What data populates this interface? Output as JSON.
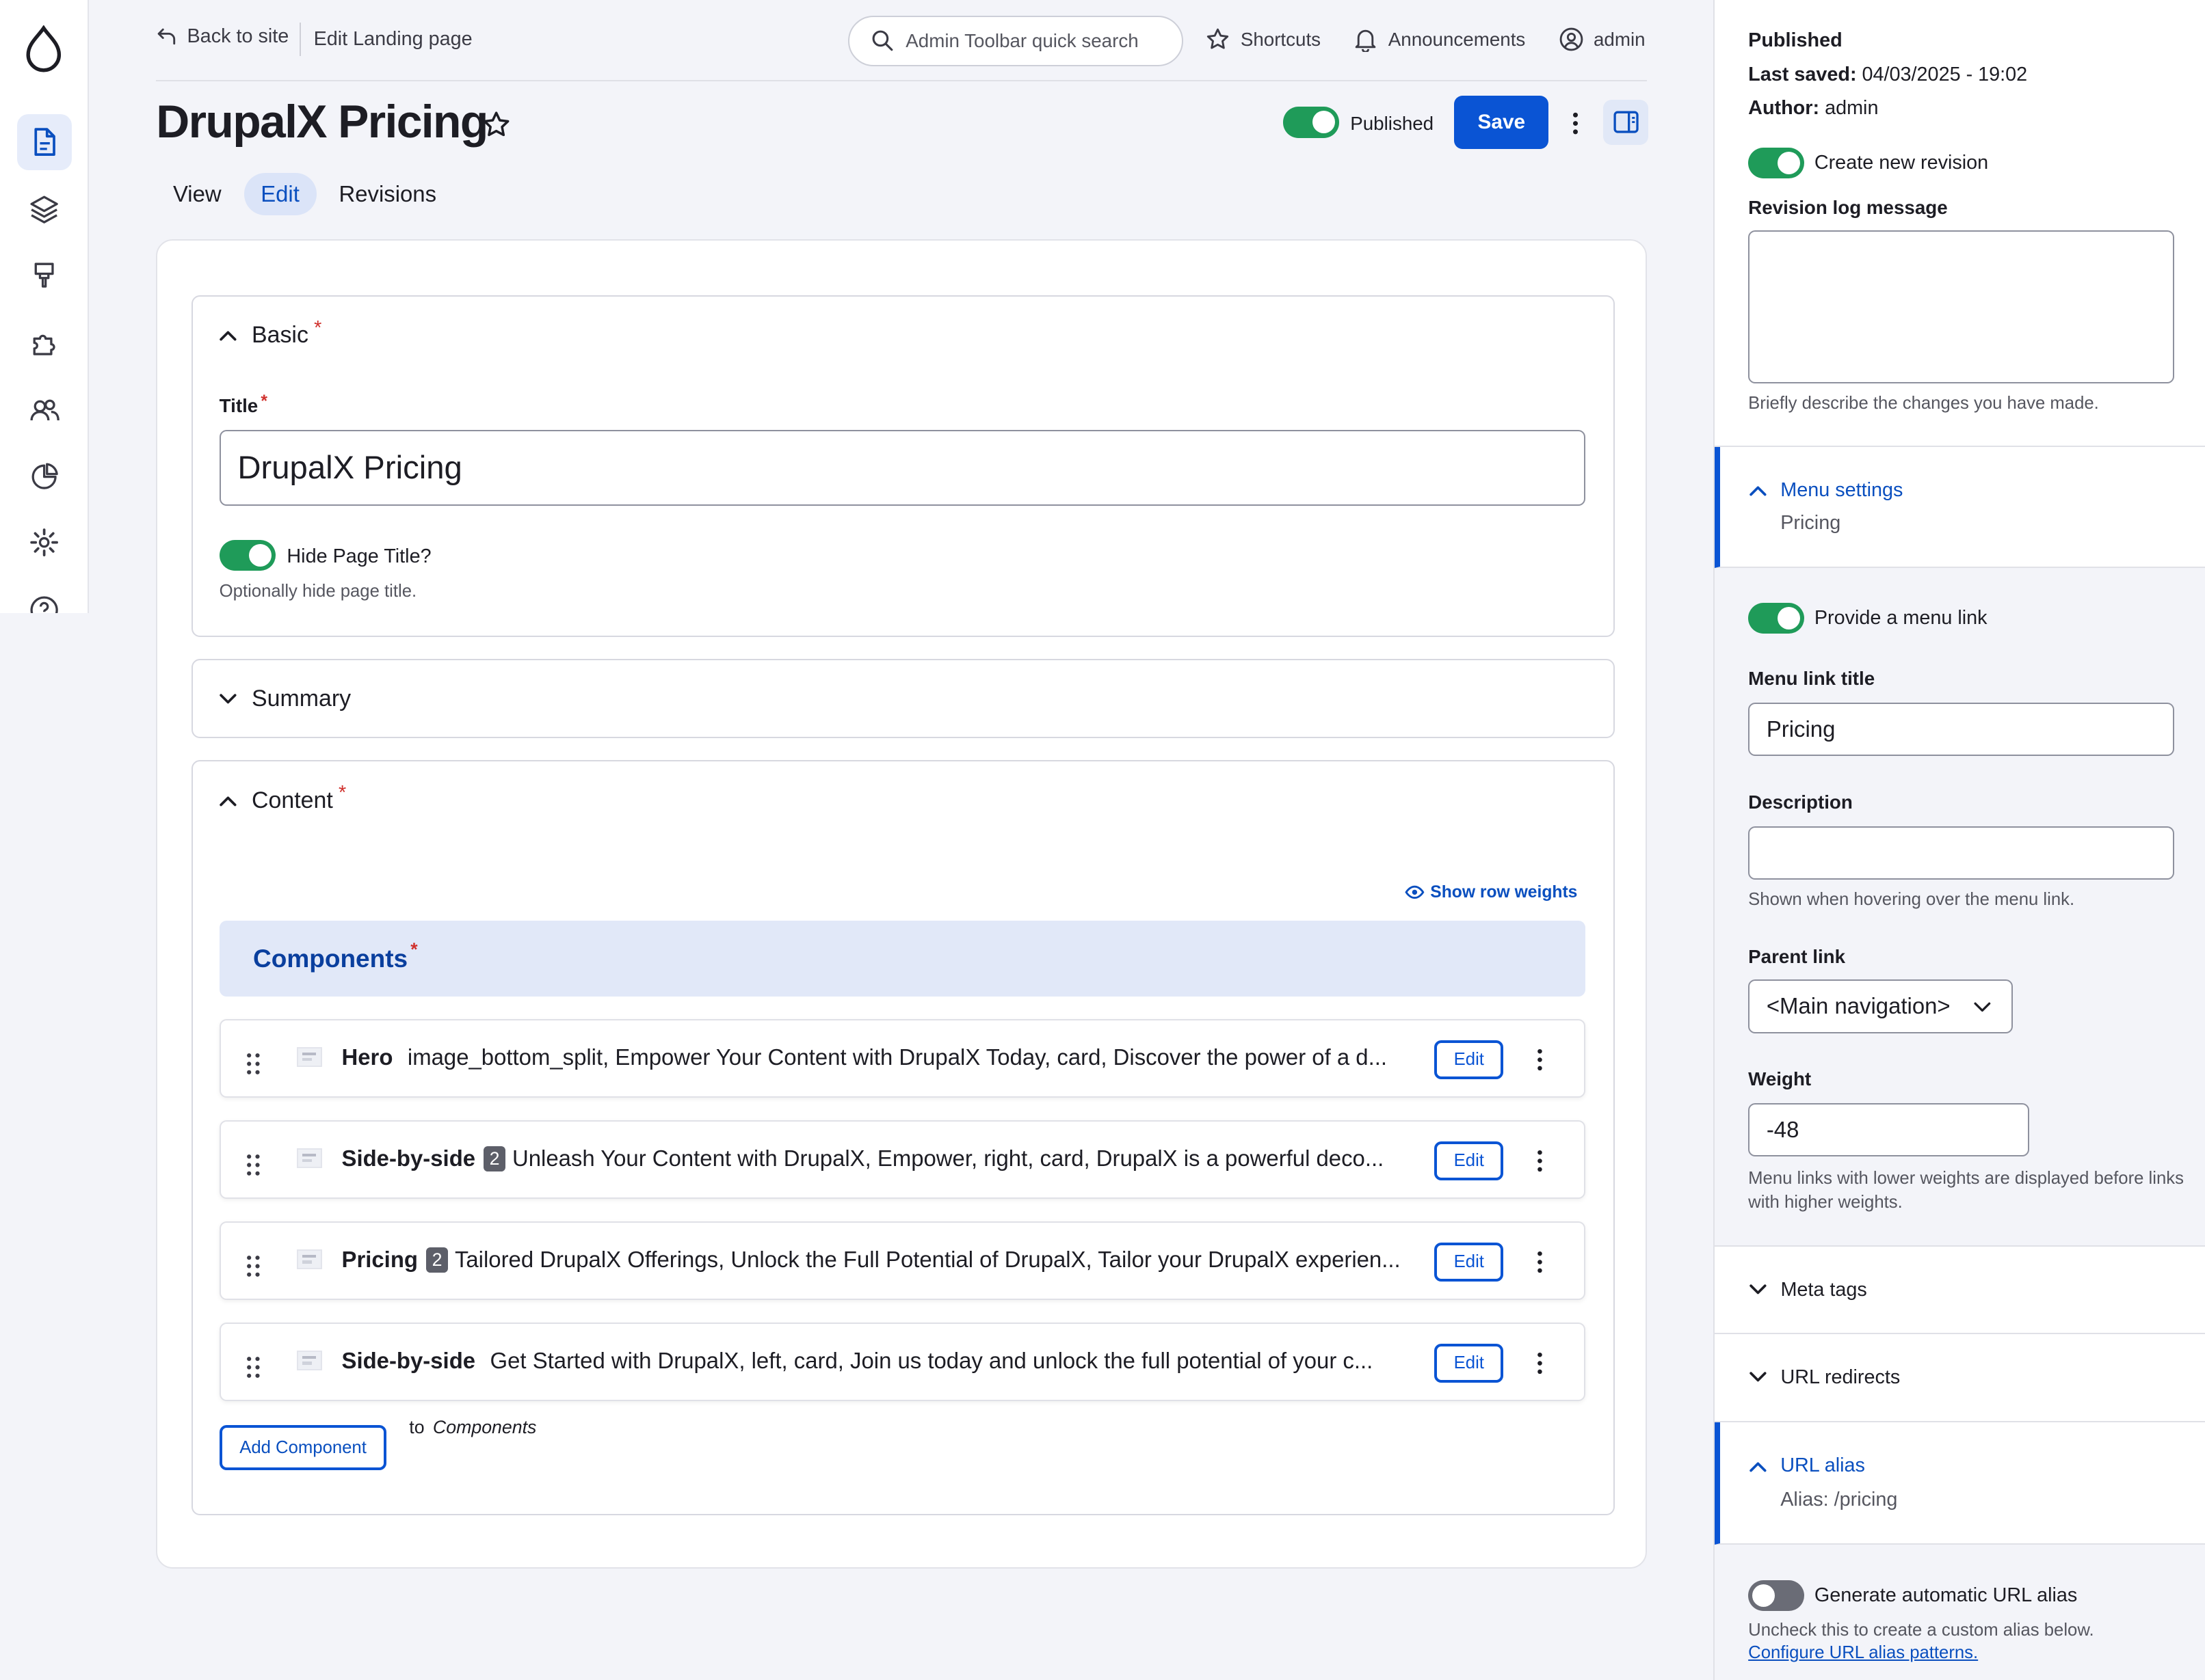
{
  "colors": {
    "accent": "#0a54d4",
    "toggle_on": "#1f9b59",
    "required": "#d0312d",
    "components_bg": "#e1e8f8"
  },
  "toolbar": {
    "back_label": "Back to site",
    "breadcrumb": "Edit Landing page",
    "search_placeholder": "Admin Toolbar quick search",
    "shortcuts": "Shortcuts",
    "announcements": "Announcements",
    "user": "admin"
  },
  "rail": {
    "items": [
      {
        "icon": "document-icon",
        "active": true
      },
      {
        "icon": "layers-icon",
        "active": false
      },
      {
        "icon": "brush-icon",
        "active": false
      },
      {
        "icon": "puzzle-icon",
        "active": false
      },
      {
        "icon": "people-icon",
        "active": false
      },
      {
        "icon": "pie-chart-icon",
        "active": false
      },
      {
        "icon": "gear-icon",
        "active": false
      },
      {
        "icon": "help-icon",
        "active": false
      }
    ]
  },
  "header": {
    "title": "DrupalX Pricing",
    "published_label": "Published",
    "published": true,
    "save_label": "Save"
  },
  "tabs": [
    {
      "label": "View",
      "active": false
    },
    {
      "label": "Edit",
      "active": true
    },
    {
      "label": "Revisions",
      "active": false
    }
  ],
  "basic": {
    "heading": "Basic",
    "required_mark": "*",
    "title_label": "Title",
    "title_value": "DrupalX Pricing",
    "hide_title_label": "Hide Page Title?",
    "hide_title_on": true,
    "hide_title_help": "Optionally hide page title."
  },
  "summary": {
    "heading": "Summary"
  },
  "content": {
    "heading": "Content",
    "show_row_weights": "Show row weights",
    "components_heading": "Components",
    "components": [
      {
        "type": "Hero",
        "badge": "",
        "text": "image_bottom_split, Empower Your Content with DrupalX Today, card, Discover the power of a d...",
        "edit": "Edit"
      },
      {
        "type": "Side-by-side",
        "badge": "2",
        "text": "Unleash Your Content with DrupalX, Empower, right, card, DrupalX is a powerful deco...",
        "edit": "Edit"
      },
      {
        "type": "Pricing",
        "badge": "2",
        "text": "Tailored DrupalX Offerings, Unlock the Full Potential of DrupalX, Tailor your DrupalX experien...",
        "edit": "Edit"
      },
      {
        "type": "Side-by-side",
        "badge": "",
        "text": "Get Started with DrupalX, left, card, Join us today and unlock the full potential of your c...",
        "edit": "Edit"
      }
    ],
    "add_component": "Add Component",
    "to_label": "to",
    "to_target": "Components"
  },
  "sidebar": {
    "status": "Published",
    "last_saved_label": "Last saved:",
    "last_saved_value": "04/03/2025 - 19:02",
    "author_label": "Author:",
    "author_value": "admin",
    "create_revision_label": "Create new revision",
    "create_revision_on": true,
    "revision_log_label": "Revision log message",
    "revision_log_value": "",
    "revision_log_help": "Briefly describe the changes you have made.",
    "menu_settings": {
      "title": "Menu settings",
      "summary": "Pricing",
      "provide_link_label": "Provide a menu link",
      "provide_link_on": true,
      "link_title_label": "Menu link title",
      "link_title_value": "Pricing",
      "description_label": "Description",
      "description_value": "",
      "description_help": "Shown when hovering over the menu link.",
      "parent_label": "Parent link",
      "parent_value": "<Main navigation>",
      "weight_label": "Weight",
      "weight_value": "-48",
      "weight_help": "Menu links with lower weights are displayed before links with higher weights."
    },
    "meta_tags": "Meta tags",
    "url_redirects": "URL redirects",
    "url_alias": {
      "title": "URL alias",
      "summary": "Alias: /pricing",
      "generate_label": "Generate automatic URL alias",
      "generate_on": false,
      "help": "Uncheck this to create a custom alias below.",
      "config_link": "Configure URL alias patterns."
    }
  }
}
